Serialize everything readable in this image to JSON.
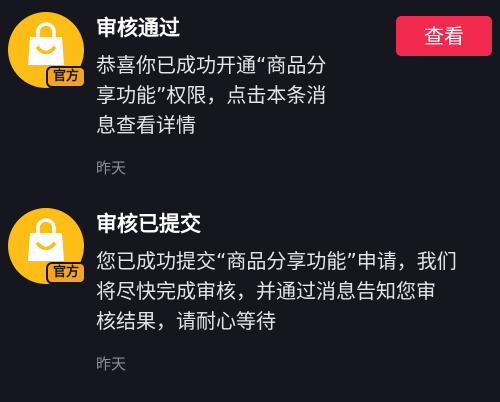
{
  "theme": {
    "background": "#16161f",
    "accent_button": "#f1294f",
    "avatar_color": "#fbbd16",
    "badge_color": "#f7a41d"
  },
  "messages": [
    {
      "avatar_icon": "shopping-bag-smile-icon",
      "badge": "官方",
      "title": "审核通过",
      "body_lines": [
        "恭喜你已成功开通“商品分",
        "享功能”权限，点击本条消",
        "息查看详情"
      ],
      "time": "昨天",
      "action_label": "查看"
    },
    {
      "avatar_icon": "shopping-bag-smile-icon",
      "badge": "官方",
      "title": "审核已提交",
      "body_lines": [
        "您已成功提交“商品分享功能”申请，我们",
        "将尽快完成审核，并通过消息告知您审",
        "核结果，请耐心等待"
      ],
      "time": "昨天"
    }
  ]
}
